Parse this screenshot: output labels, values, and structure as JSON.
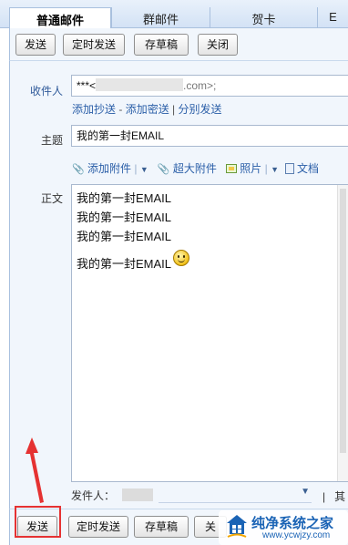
{
  "tabs": [
    {
      "label": "普通邮件",
      "active": true
    },
    {
      "label": "群邮件",
      "active": false
    },
    {
      "label": "贺卡",
      "active": false
    },
    {
      "label": "E",
      "active": false
    }
  ],
  "toolbar": {
    "send": "发送",
    "scheduled_send": "定时发送",
    "save_draft": "存草稿",
    "close": "关闭"
  },
  "toolbar_bottom": {
    "send": "发送",
    "scheduled_send": "定时发送",
    "save_draft": "存草稿",
    "close": "关"
  },
  "recipient": {
    "label": "收件人",
    "value_prefix": "***<",
    "value_suffix": ".com>;"
  },
  "recipient_links": {
    "add_cc": "添加抄送",
    "dash": " - ",
    "add_bcc": "添加密送",
    "pipe": " | ",
    "separate_send": "分别发送"
  },
  "subject": {
    "label": "主题",
    "value": "我的第一封EMAIL"
  },
  "attachments": {
    "add_attachment": "添加附件",
    "large_attachment": "超大附件",
    "photo": "照片",
    "document": "文档"
  },
  "body": {
    "label": "正文",
    "lines": [
      "我的第一封EMAIL",
      "我的第一封EMAIL",
      "我的第一封EMAIL",
      "我的第一封EMAIL"
    ]
  },
  "sender": {
    "label": "发件人：",
    "more": "其"
  },
  "watermark": {
    "title": "纯净系统之家",
    "url": "www.ycwjzy.com"
  },
  "colors": {
    "accent": "#2b5fa8",
    "toolbar_bg": "#f1f6fc",
    "annotation": "#e53232",
    "watermark": "#1a63b5"
  },
  "icons": [
    "paperclip-icon",
    "dropdown-icon",
    "large-attachment-icon",
    "photo-icon",
    "document-icon",
    "smiley-icon"
  ]
}
